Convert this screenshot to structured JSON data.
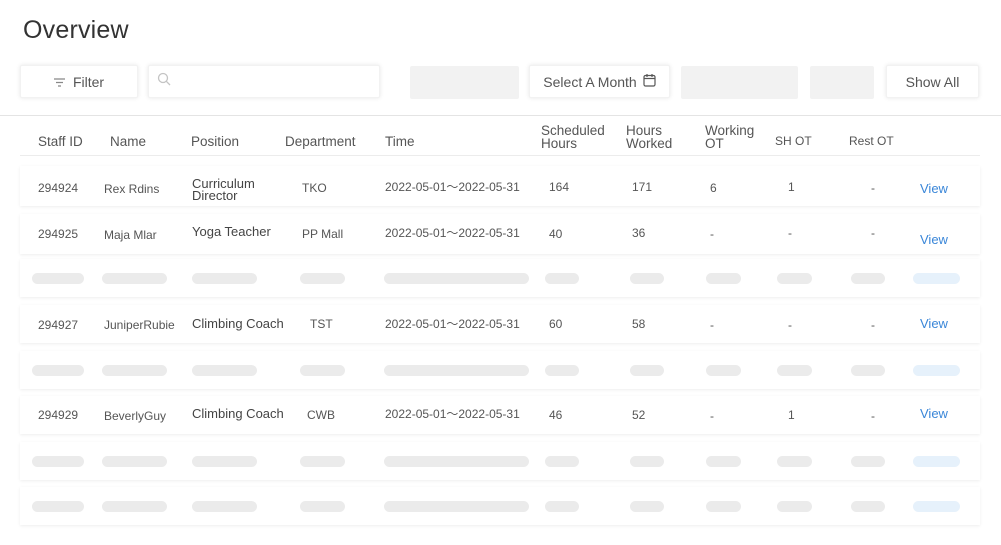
{
  "page": {
    "title": "Overview"
  },
  "toolbar": {
    "filter_label": "Filter",
    "search_placeholder": "",
    "month_label": "Select A Month",
    "show_all_label": "Show All"
  },
  "table": {
    "headers": {
      "staff_id": "Staff ID",
      "name": "Name",
      "position": "Position",
      "department": "Department",
      "time": "Time",
      "scheduled_1": "Scheduled",
      "scheduled_2": "Hours",
      "worked_1": "Hours",
      "worked_2": "Worked",
      "working_ot_1": "Working",
      "working_ot_2": "OT",
      "sh_ot": "SH OT",
      "rest_ot": "Rest OT"
    },
    "rows": [
      {
        "staff_id": "294924",
        "name": "Rex Rdins",
        "position_1": "Curriculum",
        "position_2": "Director",
        "department": "TKO",
        "time": "2022-05-01～2022-05-31",
        "scheduled": "164",
        "worked": "171",
        "working_ot": "6",
        "sh_ot": "1",
        "rest_ot": "-",
        "action": "View"
      },
      {
        "staff_id": "294925",
        "name": "Maja Mlar",
        "position": "Yoga Teacher",
        "department": "PP Mall",
        "time": "2022-05-01～2022-05-31",
        "scheduled": "40",
        "worked": "36",
        "working_ot": "-",
        "sh_ot": "-",
        "rest_ot": "-",
        "action": "View"
      },
      {
        "staff_id": "294927",
        "name": "JuniperRubie",
        "position": "Climbing Coach",
        "department": "TST",
        "time": "2022-05-01～2022-05-31",
        "scheduled": "60",
        "worked": "58",
        "working_ot": "-",
        "sh_ot": "-",
        "rest_ot": "-",
        "action": "View"
      },
      {
        "staff_id": "294929",
        "name": "BeverlyGuy",
        "position": "Climbing Coach",
        "department": "CWB",
        "time": "2022-05-01～2022-05-31",
        "scheduled": "46",
        "worked": "52",
        "working_ot": "-",
        "sh_ot": "1",
        "rest_ot": "-",
        "action": "View"
      }
    ]
  },
  "icons": {
    "filter": "filter-icon",
    "search": "search-icon",
    "calendar": "calendar-icon"
  },
  "colors": {
    "link": "#3a86d8",
    "skeleton": "#ebebeb",
    "skeleton_accent": "#e6f1fb"
  }
}
